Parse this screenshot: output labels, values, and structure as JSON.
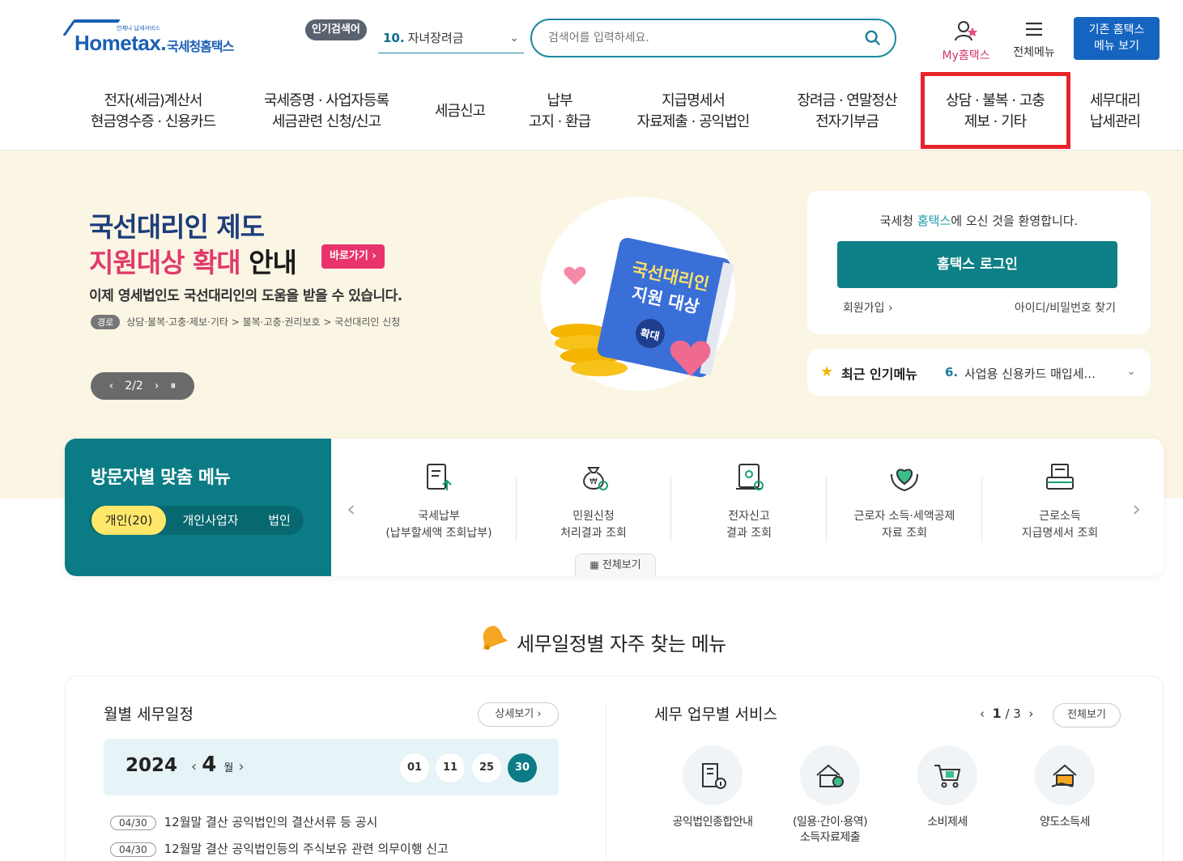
{
  "header": {
    "logo_main": "Hometax.",
    "logo_sub": "국세청홈택스",
    "logo_tiny": "언제나 납세서비스",
    "popular_badge": "인기검색어",
    "popular_num": "10.",
    "popular_term": "자녀장려금",
    "search_placeholder": "검색어를 입력하세요.",
    "my_hometax": "My홈택스",
    "all_menu": "전체메뉴",
    "old_menu_line1": "기존 홈택스",
    "old_menu_line2": "메뉴 보기"
  },
  "nav": [
    {
      "l1": "전자(세금)계산서",
      "l2": "현금영수증 · 신용카드"
    },
    {
      "l1": "국세증명 · 사업자등록",
      "l2": "세금관련 신청/신고"
    },
    {
      "l1": "세금신고",
      "l2": ""
    },
    {
      "l1": "납부",
      "l2": "고지 · 환급"
    },
    {
      "l1": "지급명세서",
      "l2": "자료제출 · 공익법인"
    },
    {
      "l1": "장려금 · 연말정산",
      "l2": "전자기부금"
    },
    {
      "l1": "상담 · 불복 · 고충",
      "l2": "제보 · 기타"
    },
    {
      "l1": "세무대리",
      "l2": "납세관리"
    }
  ],
  "banner": {
    "title1": "국선대리인 제도",
    "title2_pink": "지원대상 확대",
    "title2_dark": " 안내",
    "goto": "바로가기 ›",
    "desc": "이제 영세법인도 국선대리인의 도움을 받을 수 있습니다.",
    "path_tag": "경로",
    "path": "상담·불복·고충·제보·기타 > 불복·고충·권리보호 > 국선대리인 신청",
    "pager": "2/2",
    "book_line1": "국선대리인",
    "book_line2": "지원 대상",
    "book_badge": "확대"
  },
  "login": {
    "welcome_pre": "국세청 ",
    "welcome_hl": "홈택스",
    "welcome_post": "에 오신 것을 환영합니다.",
    "button": "홈택스 로그인",
    "join": "회원가입 ›",
    "find": "아이디/비밀번호 찾기"
  },
  "recent": {
    "label": "최근 인기메뉴",
    "num": "6.",
    "text": "사업용 신용카드 매입세..."
  },
  "visitor": {
    "title": "방문자별 맞춤 메뉴",
    "tabs": [
      "개인(20)",
      "개인사업자",
      "법인"
    ],
    "items": [
      {
        "l1": "국세납부",
        "l2": "(납부할세액 조회납부)"
      },
      {
        "l1": "민원신청",
        "l2": "처리결과 조회"
      },
      {
        "l1": "전자신고",
        "l2": "결과 조회"
      },
      {
        "l1": "근로자 소득·세액공제",
        "l2": "자료 조회"
      },
      {
        "l1": "근로소득",
        "l2": "지급명세서 조회"
      }
    ],
    "all_view": "전체보기"
  },
  "section_title": "세무일정별 자주 찾는 메뉴",
  "monthly": {
    "title": "월별 세무일정",
    "detail": "상세보기 ›",
    "year": "2024",
    "month": "4",
    "month_unit": "월",
    "days": [
      "01",
      "11",
      "25",
      "30"
    ],
    "schedules": [
      {
        "date": "04/30",
        "text": "12월말 결산 공익법인의 결산서류 등 공시"
      },
      {
        "date": "04/30",
        "text": "12월말 결산 공익법인등의 주식보유 관련 의무이행 신고"
      }
    ]
  },
  "services": {
    "title": "세무 업무별 서비스",
    "page_cur": "1",
    "page_total": "3",
    "all": "전체보기",
    "items": [
      {
        "l1": "공익법인종합안내",
        "l2": ""
      },
      {
        "l1": "(일용·간이·용역)",
        "l2": "소득자료제출"
      },
      {
        "l1": "소비제세",
        "l2": ""
      },
      {
        "l1": "양도소득세",
        "l2": ""
      }
    ]
  }
}
